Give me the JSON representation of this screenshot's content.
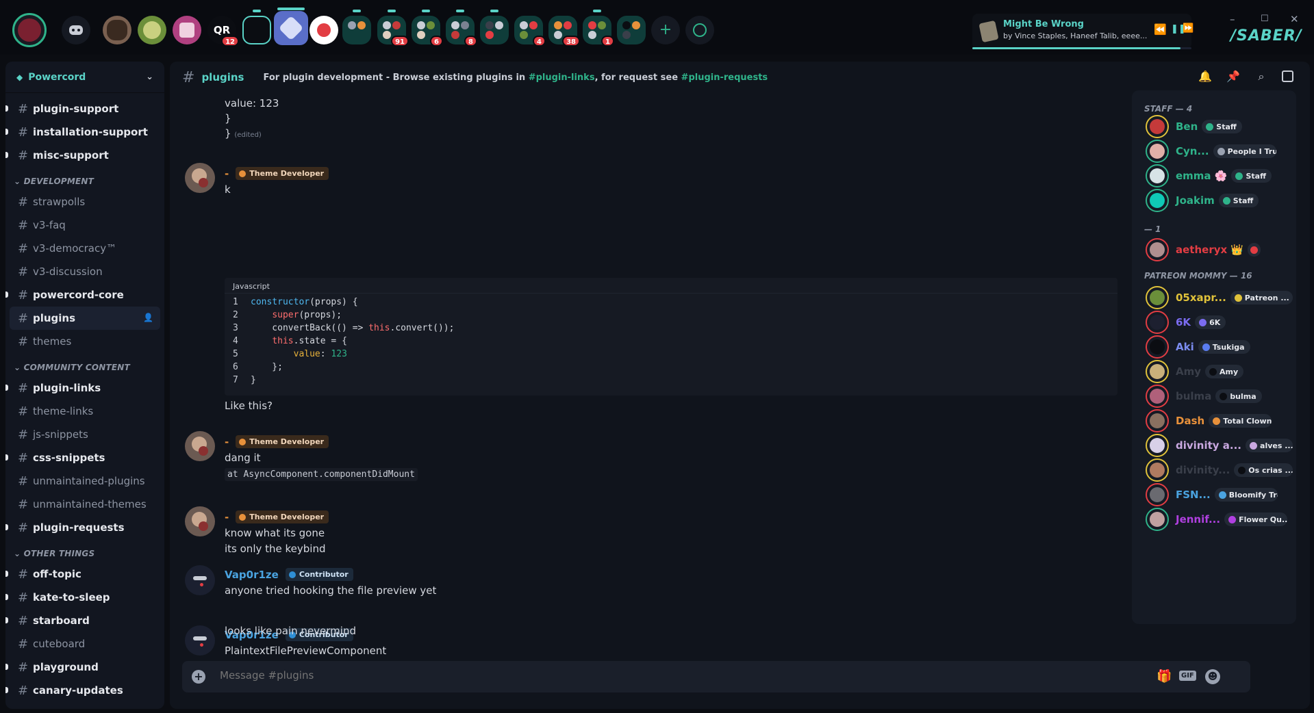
{
  "server_badges": [
    "12",
    "91",
    "6",
    "8",
    "4",
    "38",
    "1"
  ],
  "now_playing": {
    "title": "Might Be Wrong",
    "artist": "by Vince Staples, Haneef Talib, eeee...",
    "prev_icon": "skip-back-icon",
    "pause_icon": "pause-icon",
    "next_icon": "skip-forward-icon",
    "progress": 0.95
  },
  "brand_text": "/SABER/",
  "window_controls": {
    "minimize": "–",
    "maximize": "☐",
    "close": "✕"
  },
  "sidebar": {
    "guild_name": "Powercord",
    "channels_top": [
      {
        "name": "plugin-support",
        "unread": true
      },
      {
        "name": "installation-support",
        "unread": true
      },
      {
        "name": "misc-support",
        "unread": true
      }
    ],
    "categories": [
      {
        "name": "DEVELOPMENT",
        "channels": [
          {
            "name": "strawpolls",
            "unread": false
          },
          {
            "name": "v3-faq",
            "unread": false
          },
          {
            "name": "v3-democracy™",
            "unread": false
          },
          {
            "name": "v3-discussion",
            "unread": false
          },
          {
            "name": "powercord-core",
            "unread": true
          },
          {
            "name": "plugins",
            "unread": false,
            "active": true
          },
          {
            "name": "themes",
            "unread": false
          }
        ]
      },
      {
        "name": "COMMUNITY CONTENT",
        "channels": [
          {
            "name": "plugin-links",
            "unread": true
          },
          {
            "name": "theme-links",
            "unread": false
          },
          {
            "name": "js-snippets",
            "unread": false
          },
          {
            "name": "css-snippets",
            "unread": true
          },
          {
            "name": "unmaintained-plugins",
            "unread": false
          },
          {
            "name": "unmaintained-themes",
            "unread": false
          },
          {
            "name": "plugin-requests",
            "unread": true
          }
        ]
      },
      {
        "name": "OTHER THINGS",
        "channels": [
          {
            "name": "off-topic",
            "unread": true
          },
          {
            "name": "kate-to-sleep",
            "unread": true
          },
          {
            "name": "starboard",
            "unread": true
          },
          {
            "name": "cuteboard",
            "unread": false
          },
          {
            "name": "playground",
            "unread": true
          },
          {
            "name": "canary-updates",
            "unread": true
          }
        ]
      }
    ]
  },
  "header": {
    "channel": "plugins",
    "topic_prefix": "For plugin development - Browse existing plugins in ",
    "topic_link1": "#plugin-links",
    "topic_mid": ", for request see ",
    "topic_link2": "#plugin-requests"
  },
  "messages": {
    "top_code_tail": [
      "value: 123",
      "}",
      "}"
    ],
    "edited": "(edited)",
    "m1": {
      "author": "-",
      "role": "Theme Developer",
      "text": "k"
    },
    "code_lang": "Javascript",
    "after_code": "Like this?",
    "m2": {
      "author": "-",
      "role": "Theme Developer",
      "text": "dang it",
      "code": "at AsyncComponent.componentDidMount"
    },
    "m3": {
      "author": "-",
      "role": "Theme Developer",
      "line1": "know what its gone",
      "line2": "its only the keybind"
    },
    "m4": {
      "author": "Vap0r1ze",
      "role": "Contributor",
      "text": "anyone tried hooking the file preview yet"
    },
    "m5": {
      "author": "Vap0r1ze",
      "role": "Contributor",
      "line1": "PlaintextFilePreviewComponent",
      "line2": "looks like pain nevermind"
    }
  },
  "composer": {
    "placeholder": "Message #plugins"
  },
  "members": {
    "cat_staff": "STAFF — 4",
    "cat_unnamed": "— 1",
    "cat_patreon": "PATREON MOMMY — 16",
    "list": [
      {
        "name": "Ben",
        "color": "#2fb38a",
        "badge": "Staff",
        "badge_dot": "#2fb38a",
        "ring": "#e0c23a",
        "av": "#c53a3a"
      },
      {
        "name": "Cyn...",
        "color": "#2fb38a",
        "badge": "People I Trust...",
        "badge_dot": "#9aa2b1",
        "ring": "#2fb38a",
        "av": "#e0b0a8"
      },
      {
        "name": "emma 🌸",
        "color": "#2fb38a",
        "badge": "Staff",
        "badge_dot": "#2fb38a",
        "ring": "#2fb38a",
        "av": "#d7e3e6"
      },
      {
        "name": "Joakim",
        "color": "#2fb38a",
        "badge": "Staff",
        "badge_dot": "#2fb38a",
        "ring": "#2fb38a",
        "av": "#0fc9b6"
      },
      {
        "name": "aetheryx 👑",
        "color": "#e23d43",
        "badge": "",
        "badge_dot": "#e23d43",
        "ring": "#e23d43",
        "av": "#b08f8f"
      },
      {
        "name": "05xapr...",
        "color": "#e0c23a",
        "badge": "Patreon ...",
        "badge_dot": "#e0c23a",
        "ring": "#e0c23a",
        "av": "#6b8f3a"
      },
      {
        "name": "6K",
        "color": "#7b6cf0",
        "badge": "6K",
        "badge_dot": "#7b6cf0",
        "ring": "#e23d43",
        "av": "#1d2030"
      },
      {
        "name": "Aki",
        "color": "#7b8cf0",
        "badge": "Tsukiga",
        "badge_dot": "#5a7cf0",
        "ring": "#e23d43",
        "av": "#0b0d12"
      },
      {
        "name": "Amy",
        "color": "#3a3f4a",
        "badge": "Amy",
        "badge_dot": "#0b0d12",
        "ring": "#e0c23a",
        "av": "#c9b07a"
      },
      {
        "name": "bulma",
        "color": "#3a3f4a",
        "badge": "bulma",
        "badge_dot": "#0b0d12",
        "ring": "#e23d43",
        "av": "#b0607a"
      },
      {
        "name": "Dash",
        "color": "#e8913b",
        "badge": "Total Clown",
        "badge_dot": "#e8913b",
        "ring": "#e23d43",
        "av": "#8a7060"
      },
      {
        "name": "divinity a...",
        "color": "#c9a8e0",
        "badge": "alves ...",
        "badge_dot": "#c9a8e0",
        "ring": "#e0c23a",
        "av": "#d8d0e8"
      },
      {
        "name": "divinity...",
        "color": "#3a3f4a",
        "badge": "Os crias ...",
        "badge_dot": "#0b0d12",
        "ring": "#e0c23a",
        "av": "#b07a60"
      },
      {
        "name": "FSN...",
        "color": "#4aa3e0",
        "badge": "Bloomify Tran...",
        "badge_dot": "#4aa3e0",
        "ring": "#e23d43",
        "av": "#6a6a70"
      },
      {
        "name": "Jennif...",
        "color": "#b040e0",
        "badge": "Flower Qu...",
        "badge_dot": "#b040e0",
        "ring": "#2fb38a",
        "av": "#c0a0a0"
      }
    ]
  },
  "icons": {
    "bell": "bell-icon",
    "pin": "pin-icon",
    "search": "search-icon",
    "inbox": "inbox-icon",
    "gift": "gift-icon",
    "gif": "GIF",
    "emoji": "emoji-icon"
  }
}
